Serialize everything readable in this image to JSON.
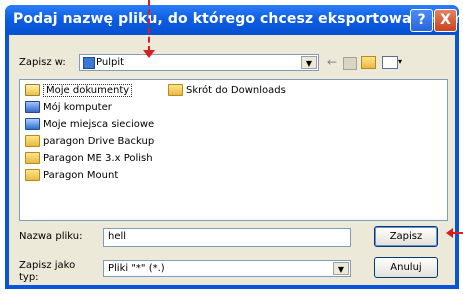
{
  "window": {
    "title": "Podaj nazwę pliku, do którego chcesz eksportować elem...",
    "help_glyph": "?",
    "close_glyph": "X"
  },
  "save_in": {
    "label": "Zapisz w:",
    "value": "Pulpit",
    "icon": "desktop-icon"
  },
  "toolbar": {
    "icons": [
      "back-icon",
      "up-folder-icon",
      "new-folder-icon",
      "view-menu-icon"
    ]
  },
  "file_list": {
    "items": [
      {
        "label": "Moje dokumenty",
        "icon": "my-documents-icon",
        "selected": true
      },
      {
        "label": "Mój komputer",
        "icon": "my-computer-icon"
      },
      {
        "label": "Moje miejsca sieciowe",
        "icon": "network-places-icon"
      },
      {
        "label": "paragon Drive Backup",
        "icon": "folder-icon"
      },
      {
        "label": "Paragon ME 3.x Polish",
        "icon": "folder-icon"
      },
      {
        "label": "Paragon Mount",
        "icon": "folder-icon"
      },
      {
        "label": "Skrót do Downloads",
        "icon": "shortcut-folder-icon"
      }
    ]
  },
  "filename": {
    "label": "Nazwa pliku:",
    "value": "hell"
  },
  "save_as_type": {
    "label": "Zapisz jako typ:",
    "value": "Pliki \"*\" (*.)"
  },
  "buttons": {
    "save": "Zapisz",
    "cancel": "Anuluj"
  },
  "colors": {
    "titlebar": "#0a5ae0",
    "dialog_face": "#ece9d8",
    "annotation_arrow": "#d81e1e"
  }
}
